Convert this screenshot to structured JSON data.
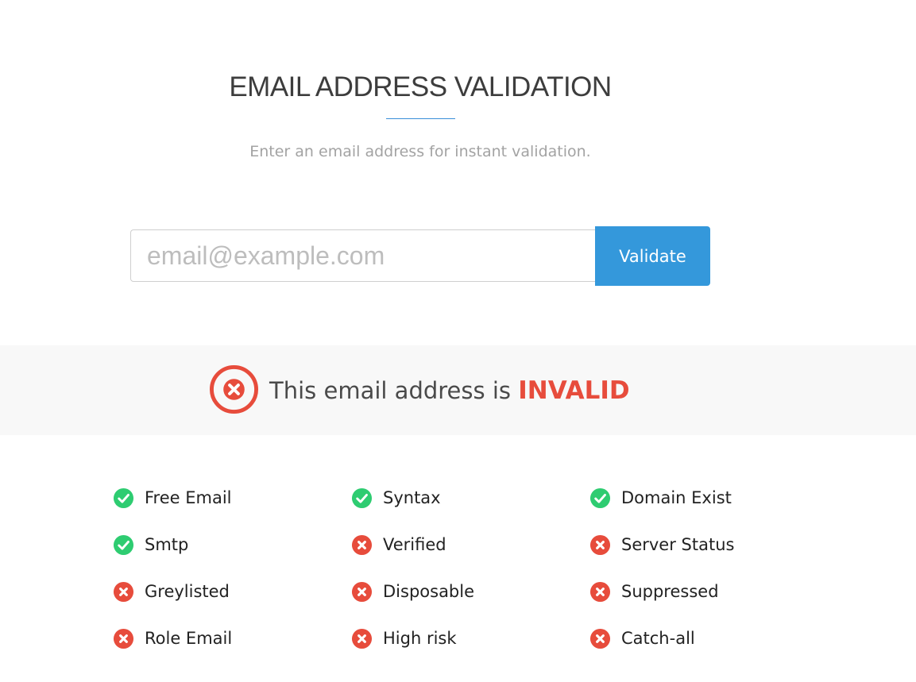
{
  "header": {
    "title": "EMAIL ADDRESS VALIDATION",
    "subtitle": "Enter an email address for instant validation."
  },
  "form": {
    "email_value": "",
    "email_placeholder": "email@example.com",
    "validate_label": "Validate"
  },
  "result": {
    "prefix": "This email address is ",
    "status": "INVALID",
    "icon": "x-circle-outline-icon",
    "status_color": "#e74c3c"
  },
  "colors": {
    "accent": "#3498db",
    "pass": "#2ecc71",
    "fail": "#e74c3c"
  },
  "checks": [
    {
      "label": "Free Email",
      "passed": true
    },
    {
      "label": "Syntax",
      "passed": true
    },
    {
      "label": "Domain Exist",
      "passed": true
    },
    {
      "label": "Smtp",
      "passed": true
    },
    {
      "label": "Verified",
      "passed": false
    },
    {
      "label": "Server Status",
      "passed": false
    },
    {
      "label": "Greylisted",
      "passed": false
    },
    {
      "label": "Disposable",
      "passed": false
    },
    {
      "label": "Suppressed",
      "passed": false
    },
    {
      "label": "Role Email",
      "passed": false
    },
    {
      "label": "High risk",
      "passed": false
    },
    {
      "label": "Catch-all",
      "passed": false
    }
  ]
}
